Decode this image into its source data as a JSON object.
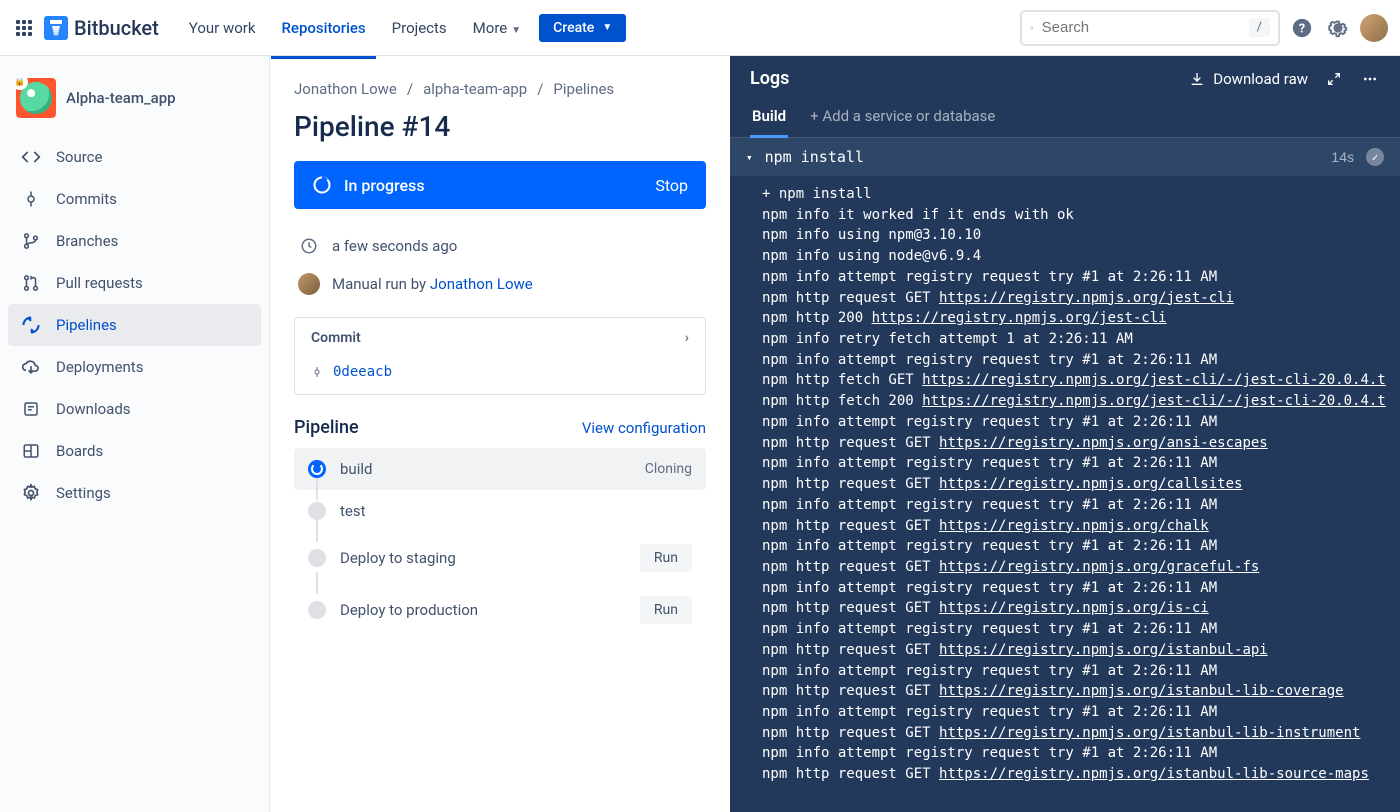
{
  "topnav": {
    "product": "Bitbucket",
    "items": [
      {
        "label": "Your work"
      },
      {
        "label": "Repositories",
        "active": true
      },
      {
        "label": "Projects"
      },
      {
        "label": "More",
        "dropdown": true
      }
    ],
    "create_label": "Create",
    "search_placeholder": "Search",
    "search_shortcut": "/"
  },
  "sidebar": {
    "repo_name": "Alpha-team_app",
    "items": [
      {
        "label": "Source",
        "icon": "code"
      },
      {
        "label": "Commits",
        "icon": "commit"
      },
      {
        "label": "Branches",
        "icon": "branch"
      },
      {
        "label": "Pull requests",
        "icon": "pull"
      },
      {
        "label": "Pipelines",
        "icon": "pipeline",
        "active": true
      },
      {
        "label": "Deployments",
        "icon": "cloud"
      },
      {
        "label": "Downloads",
        "icon": "download"
      },
      {
        "label": "Boards",
        "icon": "board"
      },
      {
        "label": "Settings",
        "icon": "gear"
      }
    ]
  },
  "breadcrumb": [
    "Jonathon Lowe",
    "alpha-team-app",
    "Pipelines"
  ],
  "page_title": "Pipeline #14",
  "status": {
    "label": "In progress",
    "action": "Stop"
  },
  "meta": {
    "time": "a few seconds ago",
    "run_prefix": "Manual run by ",
    "run_user": "Jonathon Lowe"
  },
  "commit": {
    "heading": "Commit",
    "hash": "0deeacb"
  },
  "pipeline_section": {
    "heading": "Pipeline",
    "config_link": "View configuration"
  },
  "steps": [
    {
      "name": "build",
      "status": "Cloning",
      "active": true
    },
    {
      "name": "test"
    },
    {
      "name": "Deploy to staging",
      "run": "Run"
    },
    {
      "name": "Deploy to production",
      "run": "Run"
    }
  ],
  "logs": {
    "title": "Logs",
    "download": "Download raw",
    "tabs": [
      {
        "label": "Build",
        "active": true
      },
      {
        "label": "+ Add a service or database"
      }
    ],
    "section": {
      "name": "npm install",
      "time": "14s"
    },
    "lines": [
      {
        "t": "+ npm install"
      },
      {
        "t": "npm info it worked if it ends with ok"
      },
      {
        "t": "npm info using npm@3.10.10"
      },
      {
        "t": "npm info using node@v6.9.4"
      },
      {
        "t": "npm info attempt registry request try #1 at 2:26:11 AM"
      },
      {
        "t": "npm http request GET ",
        "u": "https://registry.npmjs.org/jest-cli"
      },
      {
        "t": "npm http 200 ",
        "u": "https://registry.npmjs.org/jest-cli"
      },
      {
        "t": "npm info retry fetch attempt 1 at 2:26:11 AM"
      },
      {
        "t": "npm info attempt registry request try #1 at 2:26:11 AM"
      },
      {
        "t": "npm http fetch GET ",
        "u": "https://registry.npmjs.org/jest-cli/-/jest-cli-20.0.4.t"
      },
      {
        "t": "npm http fetch 200 ",
        "u": "https://registry.npmjs.org/jest-cli/-/jest-cli-20.0.4.t"
      },
      {
        "t": "npm info attempt registry request try #1 at 2:26:11 AM"
      },
      {
        "t": "npm http request GET ",
        "u": "https://registry.npmjs.org/ansi-escapes"
      },
      {
        "t": "npm info attempt registry request try #1 at 2:26:11 AM"
      },
      {
        "t": "npm http request GET ",
        "u": "https://registry.npmjs.org/callsites"
      },
      {
        "t": "npm info attempt registry request try #1 at 2:26:11 AM"
      },
      {
        "t": "npm http request GET ",
        "u": "https://registry.npmjs.org/chalk"
      },
      {
        "t": "npm info attempt registry request try #1 at 2:26:11 AM"
      },
      {
        "t": "npm http request GET ",
        "u": "https://registry.npmjs.org/graceful-fs"
      },
      {
        "t": "npm info attempt registry request try #1 at 2:26:11 AM"
      },
      {
        "t": "npm http request GET ",
        "u": "https://registry.npmjs.org/is-ci"
      },
      {
        "t": "npm info attempt registry request try #1 at 2:26:11 AM"
      },
      {
        "t": "npm http request GET ",
        "u": "https://registry.npmjs.org/istanbul-api"
      },
      {
        "t": "npm info attempt registry request try #1 at 2:26:11 AM"
      },
      {
        "t": "npm http request GET ",
        "u": "https://registry.npmjs.org/istanbul-lib-coverage"
      },
      {
        "t": "npm info attempt registry request try #1 at 2:26:11 AM"
      },
      {
        "t": "npm http request GET ",
        "u": "https://registry.npmjs.org/istanbul-lib-instrument"
      },
      {
        "t": "npm info attempt registry request try #1 at 2:26:11 AM"
      },
      {
        "t": "npm http request GET ",
        "u": "https://registry.npmjs.org/istanbul-lib-source-maps"
      }
    ]
  }
}
